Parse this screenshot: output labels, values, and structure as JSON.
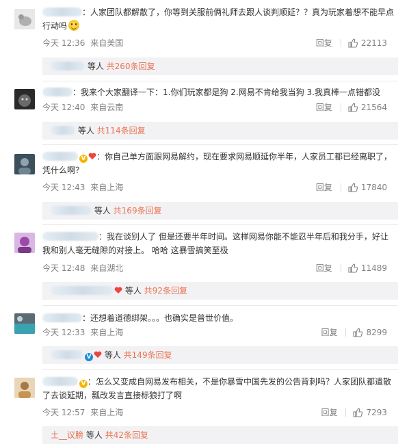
{
  "comments": [
    {
      "text": "：人家团队都解散了，你等到关服前俩礼拜去跟人谈判顺延？？真为玩家着想不能早点行动吗",
      "line1": "：人家团队都解散了，你等到关服前俩礼拜去跟人谈判顺延？？真为玩家着想不能早点",
      "line2": "行动吗",
      "emoji": "sweat-smile-emoji",
      "time": "今天 12:36",
      "location": "来自美国",
      "reply_label": "回复",
      "likes": "22113",
      "sub": {
        "prefix": "",
        "suffix": "等人",
        "more": "共260条回复"
      }
    },
    {
      "line1": "：我来个大家翻译一下：1.你们玩家都是狗 2.网易不肯给我当狗 3.我真棒一点错都没",
      "time": "今天 12:40",
      "location": "来自云南",
      "reply_label": "回复",
      "likes": "21564",
      "sub": {
        "suffix": "等人",
        "more": "共114条回复"
      }
    },
    {
      "badge": "V",
      "line1": "：你自己单方面跟网易解约，现在要求网易顺延你半年，人家员工都已经离职了，",
      "line2": "凭什么啊？",
      "time": "今天 12:43",
      "location": "来自上海",
      "reply_label": "回复",
      "likes": "17840",
      "sub": {
        "suffix": "等人",
        "more": "共169条回复"
      }
    },
    {
      "line1": "：我在谈别人了 但是还要半年时间。这样网易你能不能忍半年后和我分手，好让",
      "line2": "我和别人毫无缝隙的对接上。 哈哈 这暴雪搞笑至极",
      "time": "今天 12:48",
      "location": "来自湖北",
      "reply_label": "回复",
      "likes": "11489",
      "sub": {
        "suffix": "等人",
        "more": "共92条回复"
      }
    },
    {
      "line1": "：还想着道德绑架。。。也确实是普世价值。",
      "time": "今天 12:33",
      "location": "来自上海",
      "reply_label": "回复",
      "likes": "8299",
      "sub": {
        "badge": "V",
        "suffix": "等人",
        "more": "共149条回复"
      }
    },
    {
      "badge": "V",
      "line1": "：怎么又变成自网易发布相关，不是你暴雪中国先发的公告背刺吗？人家团队都遣散",
      "line2": "了去谈延期，瓢改发言直接标狼打了啊",
      "time": "今天 12:57",
      "location": "来自上海",
      "reply_label": "回复",
      "likes": "7293",
      "sub": {
        "prefix": "土__议膀",
        "suffix": "等人",
        "more": "共42条回复"
      }
    }
  ],
  "colors": {
    "accent": "#eb7350",
    "meta": "#808080",
    "subbg": "#f2f2f5",
    "vbadge": "#f7b500",
    "vbadge_blue": "#1a8ad8"
  },
  "icons": {
    "like": "thumbs-up-icon",
    "vip": "v-badge-icon",
    "heart": "heart-badge-icon"
  }
}
